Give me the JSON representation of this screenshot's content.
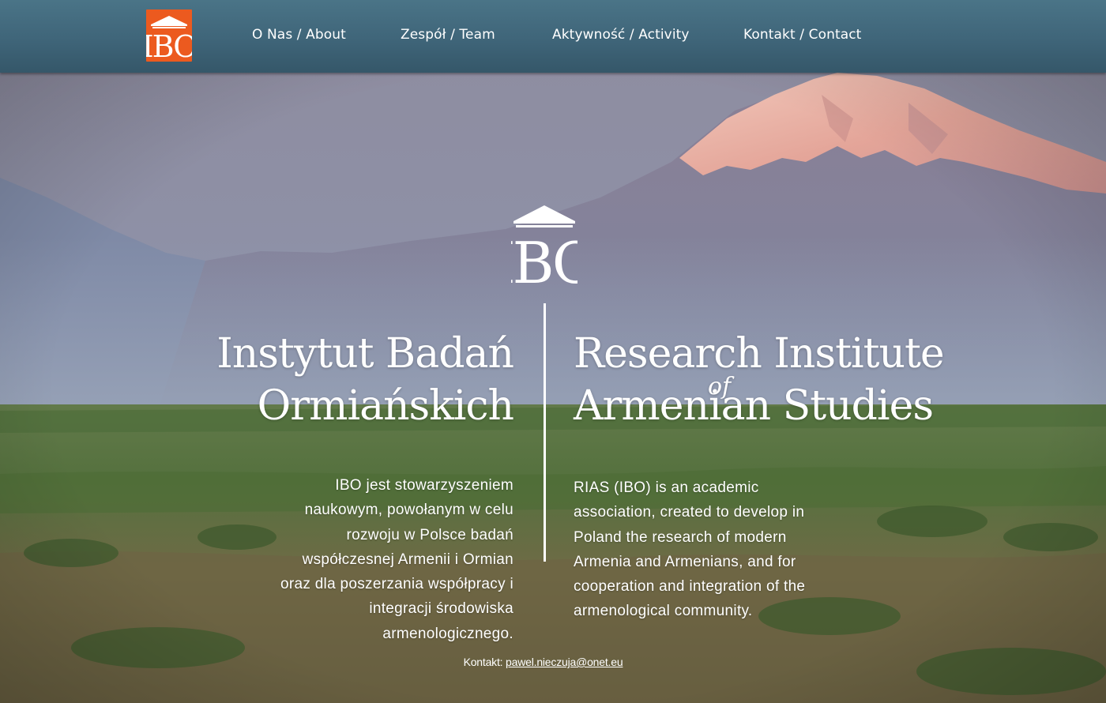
{
  "nav": {
    "logo_text": "IBO",
    "items": [
      {
        "label": "O Nas / About"
      },
      {
        "label": "Zespół / Team"
      },
      {
        "label": "Aktywność / Activity"
      },
      {
        "label": "Kontakt / Contact"
      }
    ]
  },
  "hero": {
    "logo_text": "IBO",
    "title_pl": [
      "Instytut Badań",
      "Ormiańskich"
    ],
    "title_en": [
      "Research Institute",
      "Armenian Studies"
    ],
    "title_en_connector": "of",
    "body_pl": "IBO jest stowarzyszeniem naukowym, powołanym w celu rozwoju w Polsce badań współczesnej Armenii i Ormian oraz dla poszerzania współpracy i integracji środowiska armenologicznego.",
    "body_en": "RIAS (IBO) is an academic association, created to develop in Poland the research of modern Armenia and Armenians, and for cooperation and integration of the armenological community."
  },
  "contact": {
    "label": "Kontakt:",
    "email": "pawel.nieczuja@onet.eu"
  },
  "colors": {
    "header": "#3f6579",
    "logo_bg": "#ec5a1f",
    "text": "#ffffff"
  }
}
